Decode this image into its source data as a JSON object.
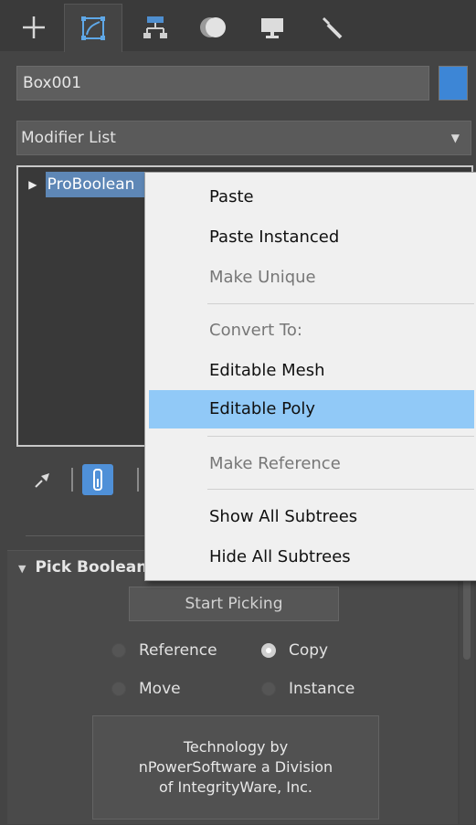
{
  "object": {
    "name": "Box001",
    "color": "#3d86d6"
  },
  "modifier_list": {
    "label": "Modifier List"
  },
  "stack": {
    "item_label": "ProBoolean"
  },
  "rollout": {
    "title": "Pick Boolean",
    "start_picking": "Start Picking",
    "radios": {
      "reference": "Reference",
      "copy": "Copy",
      "move": "Move",
      "instance": "Instance"
    },
    "selected": "Copy",
    "credits": [
      "Technology by",
      "nPowerSoftware a Division",
      "of IntegrityWare, Inc."
    ]
  },
  "context_menu": {
    "items": [
      {
        "label": "Paste",
        "enabled": true
      },
      {
        "label": "Paste Instanced",
        "enabled": true
      },
      {
        "label": "Make Unique",
        "enabled": false
      },
      {
        "label": "Convert To:",
        "enabled": false
      },
      {
        "label": "Editable Mesh",
        "enabled": true
      },
      {
        "label": "Editable Poly",
        "enabled": true,
        "highlighted": true
      },
      {
        "label": "Make Reference",
        "enabled": false
      },
      {
        "label": "Show All Subtrees",
        "enabled": true
      },
      {
        "label": "Hide All Subtrees",
        "enabled": true
      }
    ]
  },
  "icons": {
    "tabs": [
      "plus-icon",
      "modify-icon",
      "hierarchy-icon",
      "motion-icon",
      "display-icon",
      "utilities-icon"
    ],
    "tools": [
      "pin-icon",
      "show-end-result-icon"
    ]
  }
}
